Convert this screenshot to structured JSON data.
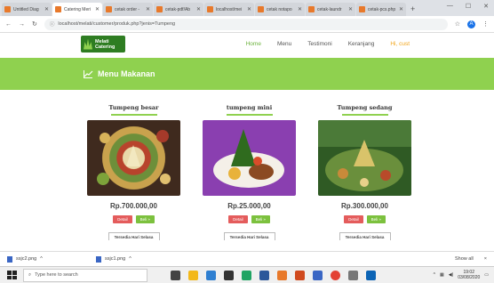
{
  "browser": {
    "tabs": [
      {
        "label": "Untitled Diag",
        "active": false
      },
      {
        "label": "Catering Meri",
        "active": true
      },
      {
        "label": "cetak order -",
        "active": false
      },
      {
        "label": "cetak-pdf/Ab",
        "active": false
      },
      {
        "label": "localhost/mei",
        "active": false
      },
      {
        "label": "cetak notapo",
        "active": false
      },
      {
        "label": "cetak-laundr",
        "active": false
      },
      {
        "label": "cetak-pcs.php",
        "active": false
      }
    ],
    "url": "localhost/melati/customer/produk.php?jenis=Tumpeng",
    "avatar": "A"
  },
  "site": {
    "logo_line1": "Melati",
    "logo_line2": "Catering",
    "menu": {
      "home": "Home",
      "menu": "Menu",
      "testimoni": "Testimoni",
      "keranjang": "Keranjang",
      "cart": "Hi, cust"
    },
    "banner_title": "Menu Makanan"
  },
  "products": [
    {
      "name": "Tumpeng besar",
      "price": "Rp.700.000,00",
      "detail": "Detail",
      "buy": "Beli »",
      "availability": "Tersedia Hari Selasa"
    },
    {
      "name": "tumpeng mini",
      "price": "Rp.25.000,00",
      "detail": "Detail",
      "buy": "Beli »",
      "availability": "Tersedia Hari Selasa"
    },
    {
      "name": "Tumpeng sedang",
      "price": "Rp.300.000,00",
      "detail": "Detail",
      "buy": "Beli »",
      "availability": "Tersedia Hari Selasa"
    }
  ],
  "downloads": {
    "items": [
      {
        "name": "ssjc2.png"
      },
      {
        "name": "ssjc1.png"
      }
    ],
    "show_all": "Show all",
    "close": "×"
  },
  "taskbar": {
    "search_placeholder": "Type here to search",
    "time": "19:02",
    "date": "03/08/2020"
  },
  "colors": {
    "accent_green": "#8fd14f",
    "detail_red": "#e45c5c",
    "cart_orange": "#f2a51a"
  }
}
